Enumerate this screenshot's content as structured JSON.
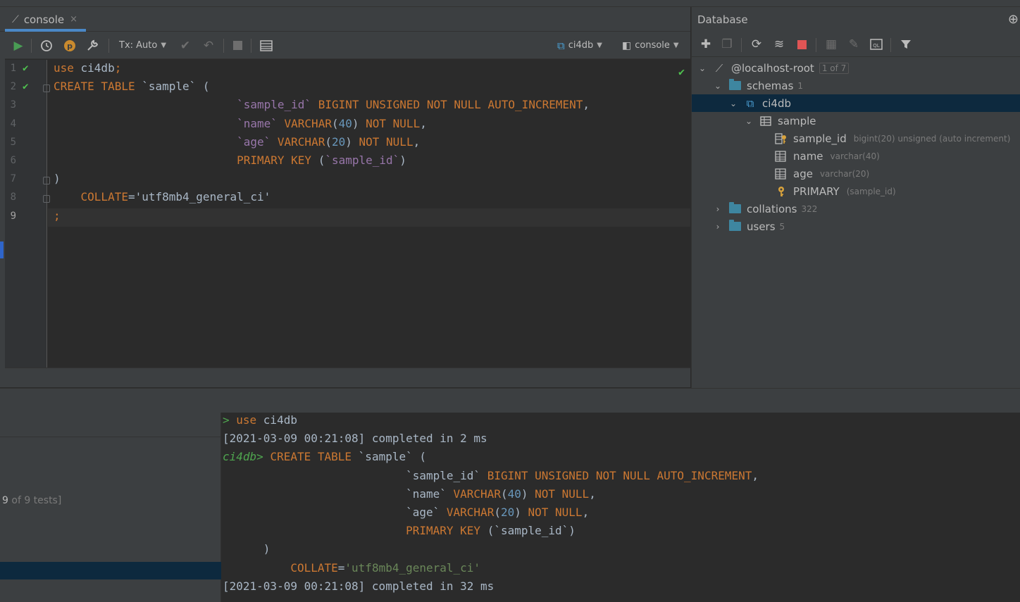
{
  "editor_tab": {
    "label": "console",
    "close": "×"
  },
  "toolbar": {
    "tx_label": "Tx: Auto",
    "db_selector": "ci4db",
    "session_selector": "console"
  },
  "editor": {
    "line_numbers": [
      "1",
      "2",
      "3",
      "4",
      "5",
      "6",
      "7",
      "8",
      "9"
    ],
    "lines": [
      [
        {
          "t": "k",
          "v": "use "
        },
        {
          "t": "p",
          "v": "ci4db"
        },
        {
          "t": "k",
          "v": ";"
        }
      ],
      [
        {
          "t": "k",
          "v": "CREATE TABLE "
        },
        {
          "t": "p",
          "v": "`sample` ("
        }
      ],
      [
        {
          "t": "p",
          "v": "                           "
        },
        {
          "t": "bt",
          "v": "`sample_id`"
        },
        {
          "t": "k",
          "v": " BIGINT UNSIGNED NOT NULL AUTO_INCREMENT"
        },
        {
          "t": "p",
          "v": ","
        }
      ],
      [
        {
          "t": "p",
          "v": "                           "
        },
        {
          "t": "bt",
          "v": "`name`"
        },
        {
          "t": "k",
          "v": " VARCHAR"
        },
        {
          "t": "p",
          "v": "("
        },
        {
          "t": "n",
          "v": "40"
        },
        {
          "t": "p",
          "v": ")"
        },
        {
          "t": "k",
          "v": " NOT NULL"
        },
        {
          "t": "p",
          "v": ","
        }
      ],
      [
        {
          "t": "p",
          "v": "                           "
        },
        {
          "t": "bt",
          "v": "`age`"
        },
        {
          "t": "k",
          "v": " VARCHAR"
        },
        {
          "t": "p",
          "v": "("
        },
        {
          "t": "n",
          "v": "20"
        },
        {
          "t": "p",
          "v": ")"
        },
        {
          "t": "k",
          "v": " NOT NULL"
        },
        {
          "t": "p",
          "v": ","
        }
      ],
      [
        {
          "t": "p",
          "v": "                           "
        },
        {
          "t": "k",
          "v": "PRIMARY KEY "
        },
        {
          "t": "p",
          "v": "("
        },
        {
          "t": "bt",
          "v": "`sample_id`"
        },
        {
          "t": "p",
          "v": ")"
        }
      ],
      [
        {
          "t": "p",
          "v": ")"
        }
      ],
      [
        {
          "t": "p",
          "v": "    "
        },
        {
          "t": "k",
          "v": "COLLATE"
        },
        {
          "t": "p",
          "v": "='utf8mb4_general_ci'"
        }
      ],
      [
        {
          "t": "k",
          "v": ";"
        }
      ]
    ]
  },
  "database_panel": {
    "title": "Database",
    "tree": {
      "connection": {
        "label": "@localhost-root",
        "badge": "1 of 7"
      },
      "schemas": {
        "label": "schemas",
        "count": "1"
      },
      "schema": {
        "label": "ci4db"
      },
      "table": {
        "label": "sample"
      },
      "columns": [
        {
          "name": "sample_id",
          "type": "bigint(20) unsigned (auto increment)",
          "icon": "key-column-icon"
        },
        {
          "name": "name",
          "type": "varchar(40)",
          "icon": "column-icon"
        },
        {
          "name": "age",
          "type": "varchar(20)",
          "icon": "column-icon"
        }
      ],
      "primary_key": {
        "name": "PRIMARY",
        "columns": "(sample_id)"
      },
      "collations": {
        "label": "collations",
        "count": "322"
      },
      "users": {
        "label": "users",
        "count": "5"
      }
    }
  },
  "test_results": {
    "passed": "9",
    "of_text": " of 9 tests]"
  },
  "console_output": {
    "lines": [
      [
        {
          "t": "prompt",
          "v": "> "
        },
        {
          "t": "k",
          "v": "use "
        },
        {
          "t": "p",
          "v": "ci4db"
        }
      ],
      [
        {
          "t": "p",
          "v": "[2021-03-09 00:21:08] completed in 2 ms"
        }
      ],
      [
        {
          "t": "pgreen",
          "v": "ci4db> "
        },
        {
          "t": "k",
          "v": "CREATE TABLE "
        },
        {
          "t": "p",
          "v": "`sample` ("
        }
      ],
      [
        {
          "t": "p",
          "v": "                           `sample_id` "
        },
        {
          "t": "k",
          "v": "BIGINT UNSIGNED NOT NULL AUTO_INCREMENT"
        },
        {
          "t": "p",
          "v": ","
        }
      ],
      [
        {
          "t": "p",
          "v": "                           `name` "
        },
        {
          "t": "k",
          "v": "VARCHAR"
        },
        {
          "t": "p",
          "v": "("
        },
        {
          "t": "n",
          "v": "40"
        },
        {
          "t": "p",
          "v": ") "
        },
        {
          "t": "k",
          "v": "NOT NULL"
        },
        {
          "t": "p",
          "v": ","
        }
      ],
      [
        {
          "t": "p",
          "v": "                           `age` "
        },
        {
          "t": "k",
          "v": "VARCHAR"
        },
        {
          "t": "p",
          "v": "("
        },
        {
          "t": "n",
          "v": "20"
        },
        {
          "t": "p",
          "v": ") "
        },
        {
          "t": "k",
          "v": "NOT NULL"
        },
        {
          "t": "p",
          "v": ","
        }
      ],
      [
        {
          "t": "p",
          "v": "                           "
        },
        {
          "t": "k",
          "v": "PRIMARY KEY "
        },
        {
          "t": "p",
          "v": "(`sample_id`)"
        }
      ],
      [
        {
          "t": "p",
          "v": "      )"
        }
      ],
      [
        {
          "t": "p",
          "v": "          "
        },
        {
          "t": "k",
          "v": "COLLATE"
        },
        {
          "t": "p",
          "v": "="
        },
        {
          "t": "s",
          "v": "'utf8mb4_general_ci'"
        }
      ],
      [
        {
          "t": "p",
          "v": "[2021-03-09 00:21:08] completed in 32 ms"
        }
      ]
    ]
  }
}
